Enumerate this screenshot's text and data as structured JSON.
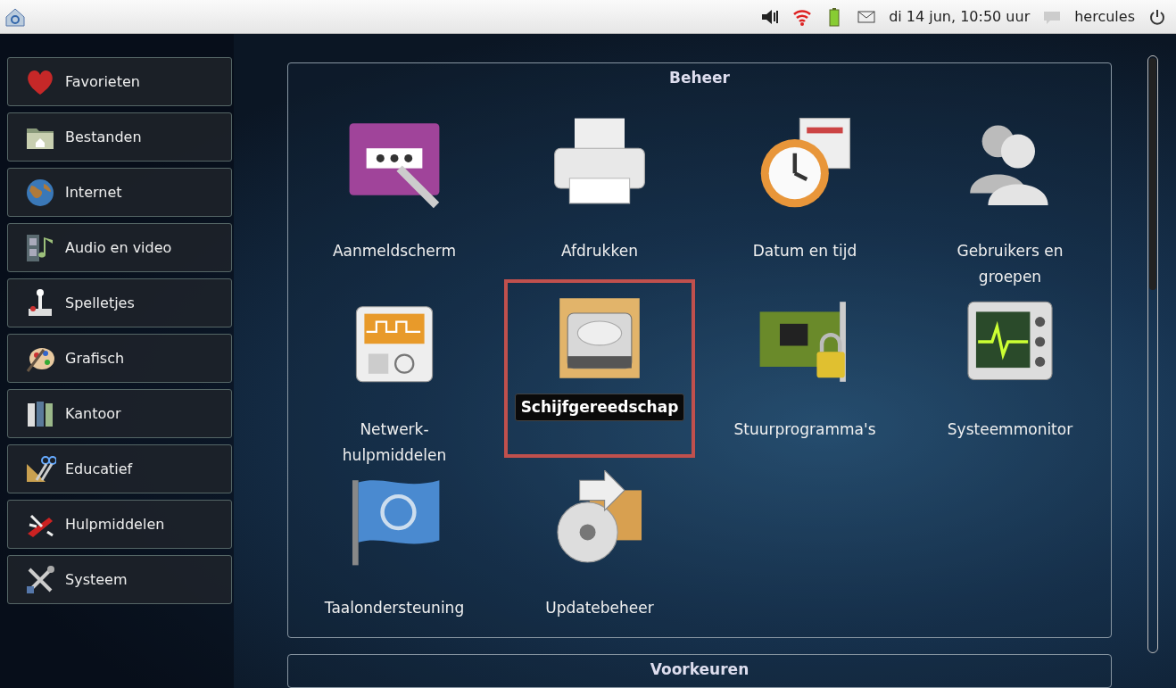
{
  "top_bar": {
    "datetime": "di 14 jun, 10:50 uur",
    "user": "hercules"
  },
  "sidebar": {
    "items": [
      {
        "label": "Favorieten"
      },
      {
        "label": "Bestanden"
      },
      {
        "label": "Internet"
      },
      {
        "label": "Audio en video"
      },
      {
        "label": "Spelletjes"
      },
      {
        "label": "Grafisch"
      },
      {
        "label": "Kantoor"
      },
      {
        "label": "Educatief"
      },
      {
        "label": "Hulpmiddelen"
      },
      {
        "label": "Systeem"
      }
    ]
  },
  "sections": [
    {
      "title": "Beheer",
      "items": [
        {
          "label": "Aanmeldscherm",
          "selected": false
        },
        {
          "label": "Afdrukken",
          "selected": false
        },
        {
          "label": "Datum en tijd",
          "selected": false
        },
        {
          "label": "Gebruikers en groepen",
          "selected": false
        },
        {
          "label": "Netwerk-hulpmiddelen",
          "selected": false
        },
        {
          "label": "Schijfgereedschap",
          "selected": true
        },
        {
          "label": "Stuurprogramma's",
          "selected": false
        },
        {
          "label": "Systeemmonitor",
          "selected": false
        },
        {
          "label": "Taalondersteuning",
          "selected": false
        },
        {
          "label": "Updatebeheer",
          "selected": false
        }
      ]
    },
    {
      "title": "Voorkeuren"
    }
  ]
}
